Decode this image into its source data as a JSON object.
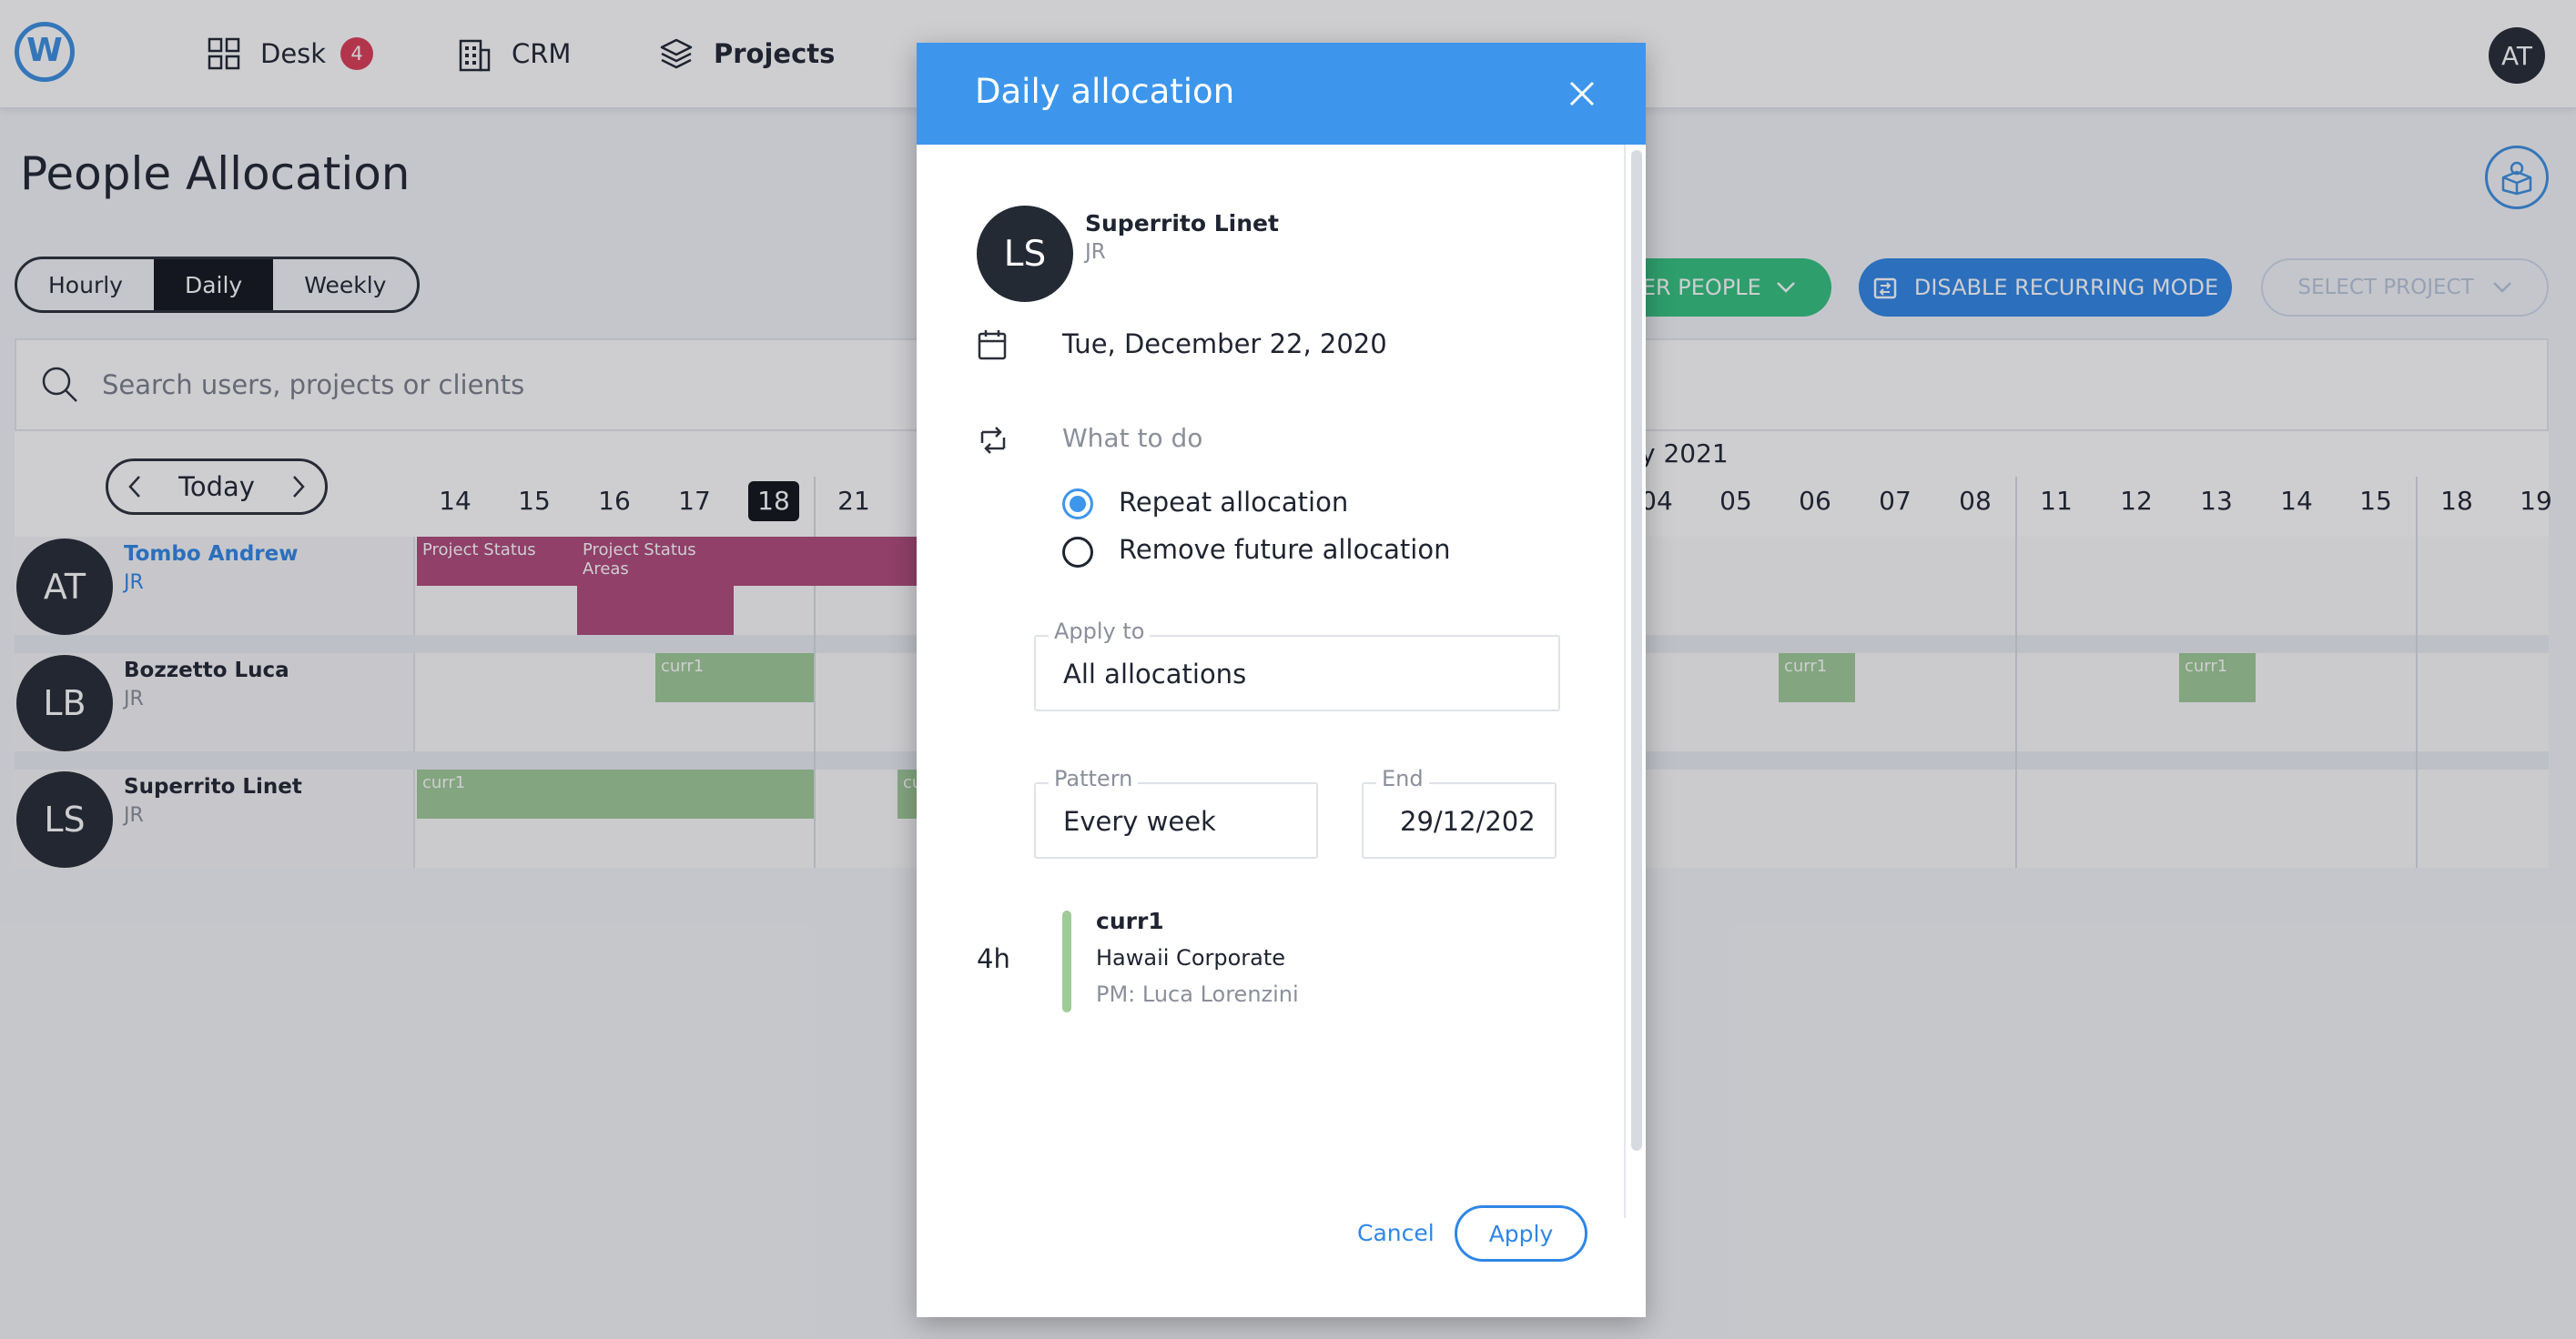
{
  "nav": {
    "items": [
      {
        "label": "Desk",
        "badge": "4"
      },
      {
        "label": "CRM"
      },
      {
        "label": "Projects"
      }
    ],
    "user_initials": "AT"
  },
  "page": {
    "title": "People Allocation",
    "modes": [
      "Hourly",
      "Daily",
      "Weekly"
    ],
    "active_mode": "Daily",
    "filter_button": "TER PEOPLE",
    "disable_button": "DISABLE RECURRING MODE",
    "select_project": "SELECT PROJECT",
    "search_placeholder": "Search users, projects or clients",
    "today_label": "Today"
  },
  "timeline": {
    "month_label": "y 2021",
    "days_left": [
      "14",
      "15",
      "16",
      "17",
      "18",
      "21"
    ],
    "today_day": "18",
    "days_right": [
      "04",
      "05",
      "06",
      "07",
      "08",
      "11",
      "12",
      "13",
      "14",
      "15",
      "18",
      "19"
    ]
  },
  "people": [
    {
      "initials": "AT",
      "name": "Tombo Andrew",
      "role": "JR",
      "highlight": true
    },
    {
      "initials": "LB",
      "name": "Bozzetto Luca",
      "role": "JR",
      "highlight": false
    },
    {
      "initials": "LS",
      "name": "Superrito Linet",
      "role": "JR",
      "highlight": false
    }
  ],
  "allocations": {
    "a1": "Project Status",
    "a2": "Project Status Areas",
    "g1": "curr1",
    "g2": "curr1",
    "g3": "curr1",
    "g4": "curr1",
    "g5": "cu"
  },
  "modal": {
    "title": "Daily allocation",
    "person_initials": "LS",
    "person_name": "Superrito Linet",
    "person_role": "JR",
    "date": "Tue, December 22, 2020",
    "what_to_do": "What to do",
    "options": [
      "Repeat allocation",
      "Remove future allocation"
    ],
    "selected_option": "Repeat allocation",
    "apply_to_label": "Apply to",
    "apply_to_value": "All allocations",
    "pattern_label": "Pattern",
    "pattern_value": "Every week",
    "end_label": "End",
    "end_value": "29/12/202",
    "hours": "4h",
    "project_name": "curr1",
    "client": "Hawaii Corporate",
    "pm": "PM: Luca Lorenzini",
    "cancel": "Cancel",
    "apply": "Apply"
  },
  "colors": {
    "accent": "#3d96ec",
    "primary_button": "#2f86e6",
    "filter_button": "#32c27e",
    "alloc_purple": "#b0497a",
    "alloc_green": "#9fcb97",
    "badge": "#dc3b55"
  }
}
